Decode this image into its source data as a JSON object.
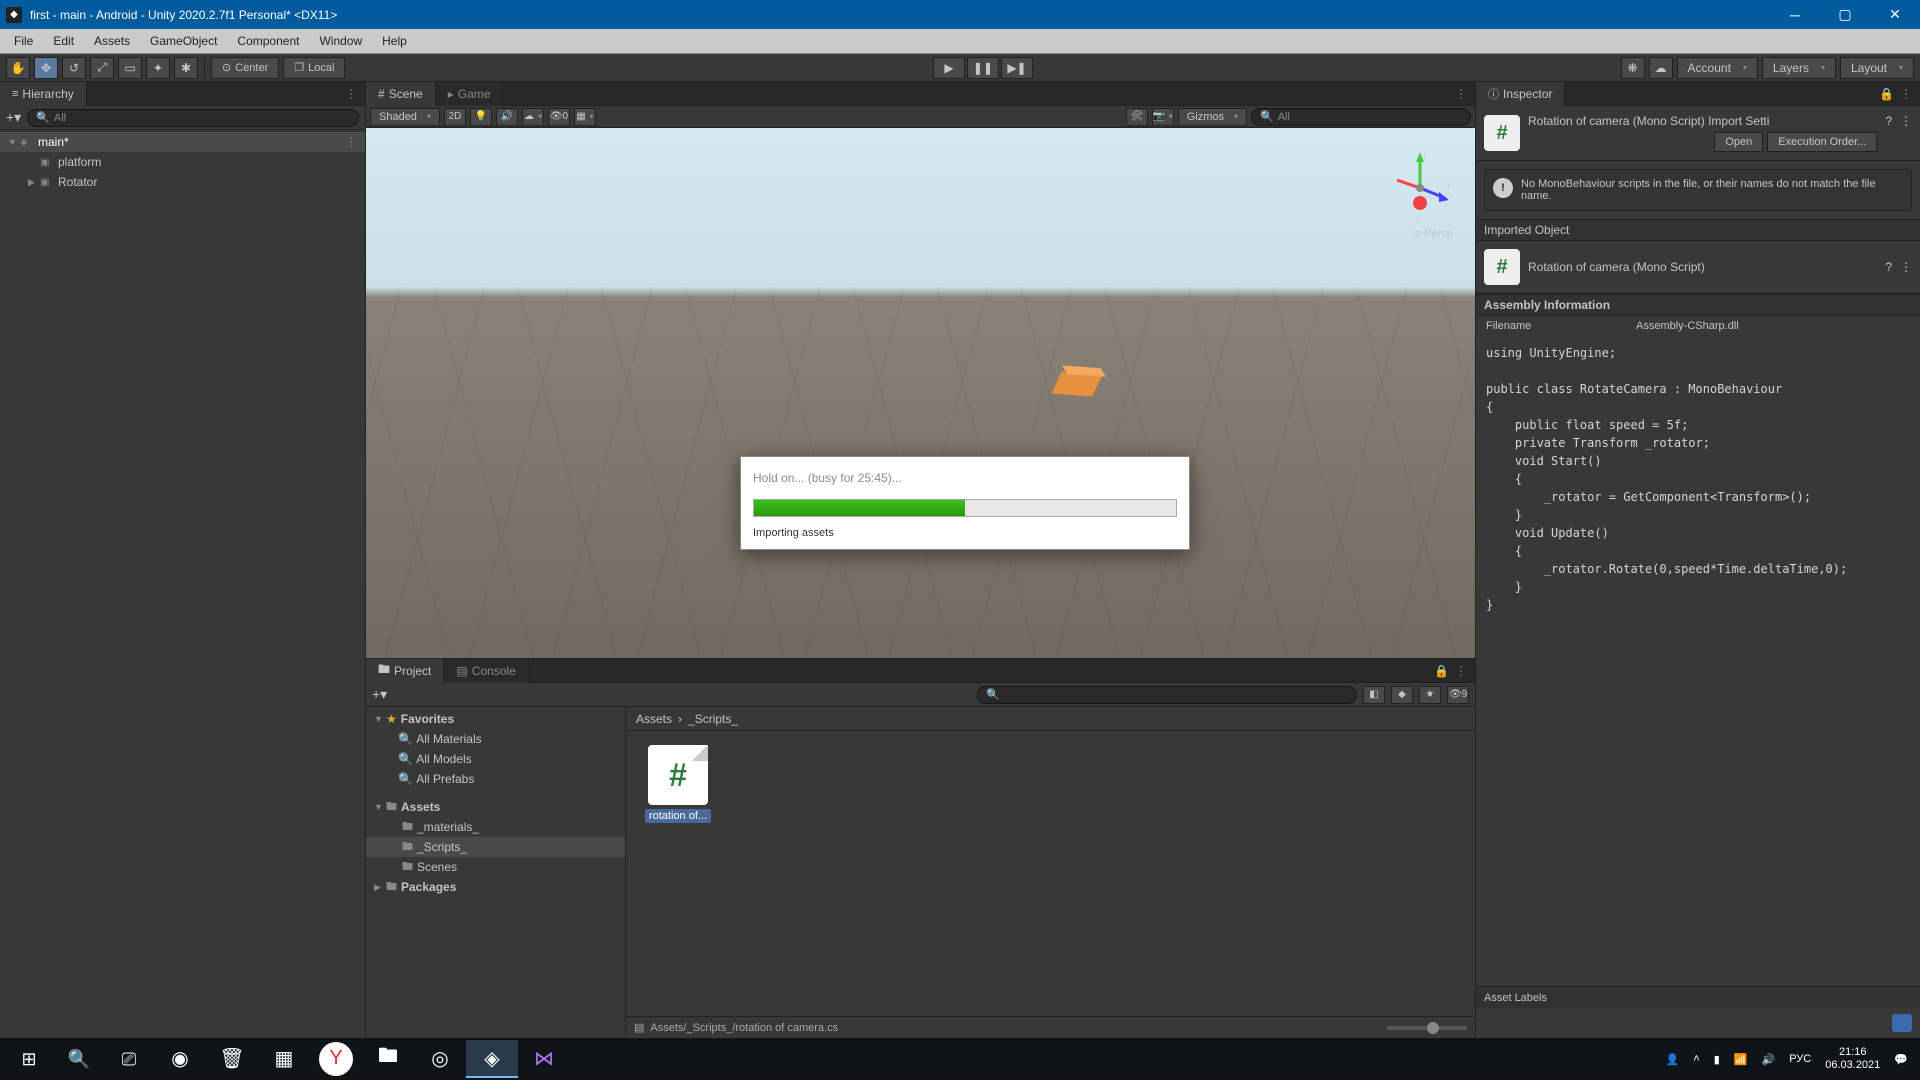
{
  "window": {
    "title": "first - main - Android - Unity 2020.2.7f1 Personal* <DX11>"
  },
  "menu": {
    "items": [
      "File",
      "Edit",
      "Assets",
      "GameObject",
      "Component",
      "Window",
      "Help"
    ]
  },
  "toolbar": {
    "pivot_mode": "Center",
    "handle_space": "Local",
    "account": "Account",
    "layers": "Layers",
    "layout": "Layout"
  },
  "hierarchy": {
    "title": "Hierarchy",
    "search_placeholder": "All",
    "scene": "main*",
    "items": [
      "platform",
      "Rotator"
    ]
  },
  "scene_tabs": {
    "scene": "Scene",
    "game": "Game"
  },
  "scene_toolbar": {
    "shading": "Shaded",
    "mode2d": "2D",
    "hidden_count": "0",
    "gizmos": "Gizmos",
    "search_placeholder": "All",
    "persp": "Persp"
  },
  "modal": {
    "title": "Hold on... (busy for 25:45)...",
    "status": "Importing assets",
    "progress_pct": 50
  },
  "project": {
    "tab_project": "Project",
    "tab_console": "Console",
    "hidden_badge": "9",
    "favorites_label": "Favorites",
    "favorites": [
      "All Materials",
      "All Models",
      "All Prefabs"
    ],
    "assets_label": "Assets",
    "folders": [
      "_materials_",
      "_Scripts_",
      "Scenes"
    ],
    "packages_label": "Packages",
    "breadcrumb": [
      "Assets",
      "_Scripts_"
    ],
    "asset_name": "rotation of...",
    "footer_path": "Assets/_Scripts_/rotation of camera.cs"
  },
  "inspector": {
    "title": "Inspector",
    "object_title": "Rotation of camera (Mono Script) Import Setti",
    "open_btn": "Open",
    "exec_order_btn": "Execution Order...",
    "warning": "No MonoBehaviour scripts in the file, or their names do not match the file name.",
    "imported_header": "Imported Object",
    "imported_title": "Rotation of camera (Mono Script)",
    "assembly_header": "Assembly Information",
    "assembly_filename_label": "Filename",
    "assembly_filename_value": "Assembly-CSharp.dll",
    "code": "using UnityEngine;\n\npublic class RotateCamera : MonoBehaviour\n{\n    public float speed = 5f;\n    private Transform _rotator;\n    void Start()\n    {\n        _rotator = GetComponent<Transform>();\n    }\n    void Update()\n    {\n        _rotator.Rotate(0,speed*Time.deltaTime,0);\n    }\n}",
    "asset_labels": "Asset Labels"
  },
  "taskbar": {
    "lang": "РУС",
    "time": "21:16",
    "date": "06.03.2021"
  }
}
